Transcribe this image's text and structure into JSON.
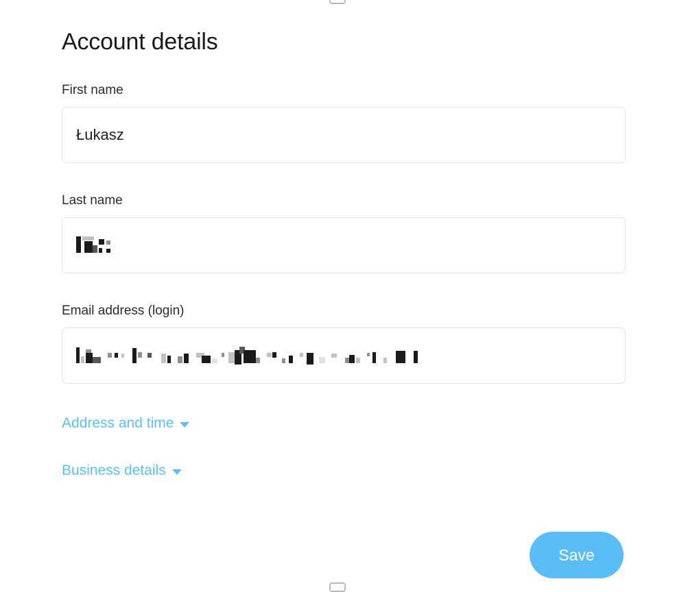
{
  "window": {
    "background_color": "#ffffff",
    "edge_nubs": [
      "top-chrome-nub",
      "bottom-chrome-nub"
    ]
  },
  "header": {
    "title": "Account details"
  },
  "form": {
    "fields": [
      {
        "id": "first-name",
        "label": "First name",
        "value": "Łukasz",
        "placeholder": "",
        "redacted": false
      },
      {
        "id": "last-name",
        "label": "Last name",
        "value": "",
        "placeholder": "",
        "redacted": true,
        "redaction_note": "value pixelated for privacy"
      },
      {
        "id": "email-address",
        "label": "Email address (login)",
        "value": "",
        "placeholder": "",
        "redacted": true,
        "redaction_note": "value pixelated for privacy"
      }
    ],
    "disclosures": [
      {
        "id": "address-and-time",
        "label": "Address and time",
        "icon": "caret-down-icon",
        "expanded": false
      },
      {
        "id": "business-details",
        "label": "Business details",
        "icon": "caret-down-icon",
        "expanded": false
      }
    ],
    "actions": {
      "save_label": "Save"
    }
  },
  "colors": {
    "accent_blue": "#5bc0f5",
    "button_blue": "#5bbdf5",
    "input_border": "#e3e3e3",
    "text_primary": "#1a1a1a",
    "label_text": "#2b2b2b"
  }
}
